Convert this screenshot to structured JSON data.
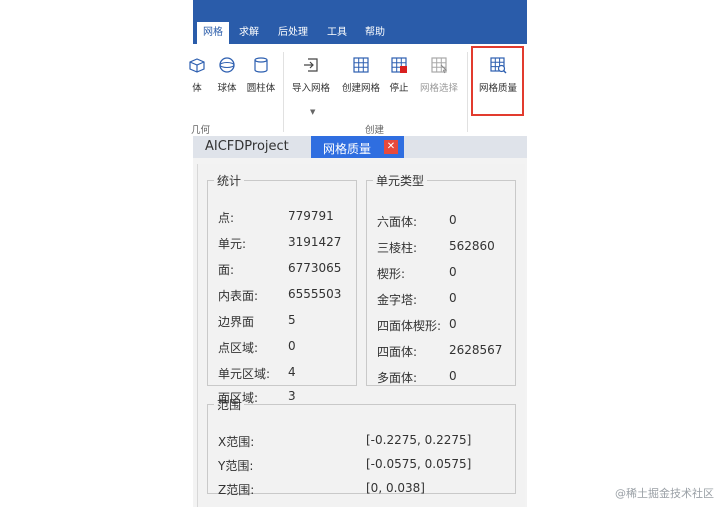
{
  "menu": {
    "tabs": [
      "网格",
      "求解",
      "后处理",
      "工具",
      "帮助"
    ]
  },
  "ribbon": {
    "partial_labels": [
      "体",
      "球体",
      "圆柱体"
    ],
    "partial_group": "几何",
    "buttons": [
      "导入网格",
      "创建网格",
      "停止",
      "网格选择",
      "网格质量"
    ],
    "group": "创建"
  },
  "doc_tabs": {
    "project": "AICFDProject",
    "active": "网格质量",
    "close_glyph": "✕"
  },
  "stats": {
    "title": "统计",
    "rows": [
      {
        "label": "点:",
        "value": "779791"
      },
      {
        "label": "单元:",
        "value": "3191427"
      },
      {
        "label": "面:",
        "value": "6773065"
      },
      {
        "label": "内表面:",
        "value": "6555503"
      },
      {
        "label": "边界面",
        "value": "5"
      },
      {
        "label": "点区域:",
        "value": "0"
      },
      {
        "label": "单元区域:",
        "value": "4"
      },
      {
        "label": "面区域:",
        "value": "3"
      }
    ]
  },
  "cell_types": {
    "title": "单元类型",
    "rows": [
      {
        "label": "六面体:",
        "value": "0"
      },
      {
        "label": "三棱柱:",
        "value": "562860"
      },
      {
        "label": "楔形:",
        "value": "0"
      },
      {
        "label": "金字塔:",
        "value": "0"
      },
      {
        "label": "四面体楔形:",
        "value": "0"
      },
      {
        "label": "四面体:",
        "value": "2628567"
      },
      {
        "label": "多面体:",
        "value": "0"
      }
    ]
  },
  "range": {
    "title": "范围",
    "rows": [
      {
        "label": "X范围:",
        "value": "[-0.2275, 0.2275]"
      },
      {
        "label": "Y范围:",
        "value": "[-0.0575, 0.0575]"
      },
      {
        "label": "Z范围:",
        "value": "[0, 0.038]"
      }
    ]
  },
  "watermark": "@稀土掘金技术社区",
  "colors": {
    "menubar": "#2a5caa",
    "active_tab": "#2f6ee0",
    "highlight": "#e23b2e",
    "close": "#e84a3c",
    "icon_blue": "#2d5fb0",
    "stop_red": "#d92020"
  }
}
